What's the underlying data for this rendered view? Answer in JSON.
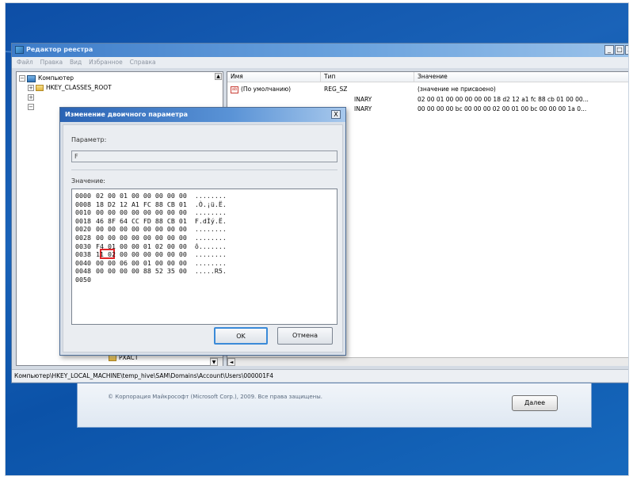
{
  "registry_editor": {
    "title": "Редактор реестра",
    "window_controls": [
      "_",
      "□",
      "X"
    ],
    "menu": [
      "Файл",
      "Правка",
      "Вид",
      "Избранное",
      "Справка"
    ],
    "tree": {
      "root": "Компьютер",
      "items": [
        "HKEY_CLASSES_ROOT",
        "PXACT"
      ]
    },
    "list": {
      "columns": [
        "Имя",
        "Тип",
        "Значение"
      ],
      "rows": [
        {
          "name": "(По умолчанию)",
          "type": "REG_SZ",
          "value": "(значение не присвоено)"
        },
        {
          "name": "",
          "type": "INARY",
          "value": "02 00 01 00 00 00 00 00 18 d2 12 a1 fc 88 cb 01 00 00..."
        },
        {
          "name": "",
          "type": "INARY",
          "value": "00 00 00 00 bc 00 00 00 02 00 01 00 bc 00 00 00 1a 0..."
        }
      ]
    },
    "status_path": "Компьютер\\HKEY_LOCAL_MACHINE\\temp_hive\\SAM\\Domains\\Account\\Users\\000001F4"
  },
  "dialog": {
    "title": "Изменение двоичного параметра",
    "close_label": "X",
    "param_label": "Параметр:",
    "param_value": "F",
    "value_label": "Значение:",
    "hex_rows": [
      {
        "offset": "0000",
        "bytes": "02 00 01 00 00 00 00 00",
        "ascii": "........"
      },
      {
        "offset": "0008",
        "bytes": "18 D2 12 A1 FC 88 CB 01",
        "ascii": ".Ò.¡ü.Ë."
      },
      {
        "offset": "0010",
        "bytes": "00 00 00 00 00 00 00 00",
        "ascii": "........"
      },
      {
        "offset": "0018",
        "bytes": "46 8F 64 CC FD 88 CB 01",
        "ascii": "F.dÌý.Ë."
      },
      {
        "offset": "0020",
        "bytes": "00 00 00 00 00 00 00 00",
        "ascii": "........"
      },
      {
        "offset": "0028",
        "bytes": "00 00 00 00 00 00 00 00",
        "ascii": "........"
      },
      {
        "offset": "0030",
        "bytes": "F4 01 00 00 01 02 00 00",
        "ascii": "ô......."
      },
      {
        "offset": "0038",
        "bytes": "11 02 00 00 00 00 00 00",
        "ascii": "........"
      },
      {
        "offset": "0040",
        "bytes": "00 00 06 00 01 00 00 00",
        "ascii": "........"
      },
      {
        "offset": "0048",
        "bytes": "00 00 00 00 88 52 35 00",
        "ascii": ".....R5."
      },
      {
        "offset": "0050",
        "bytes": "",
        "ascii": ""
      }
    ],
    "highlighted_byte": "11",
    "ok_label": "OK",
    "cancel_label": "Отмена"
  },
  "setup_window": {
    "copyright": "© Корпорация Майкрософт (Microsoft Corp.), 2009. Все права защищены.",
    "next_label": "Далее"
  },
  "colors": {
    "highlight_border": "#e0262a",
    "desktop_blue": "#1a63b8",
    "title_blue": "#3d7cc9"
  }
}
